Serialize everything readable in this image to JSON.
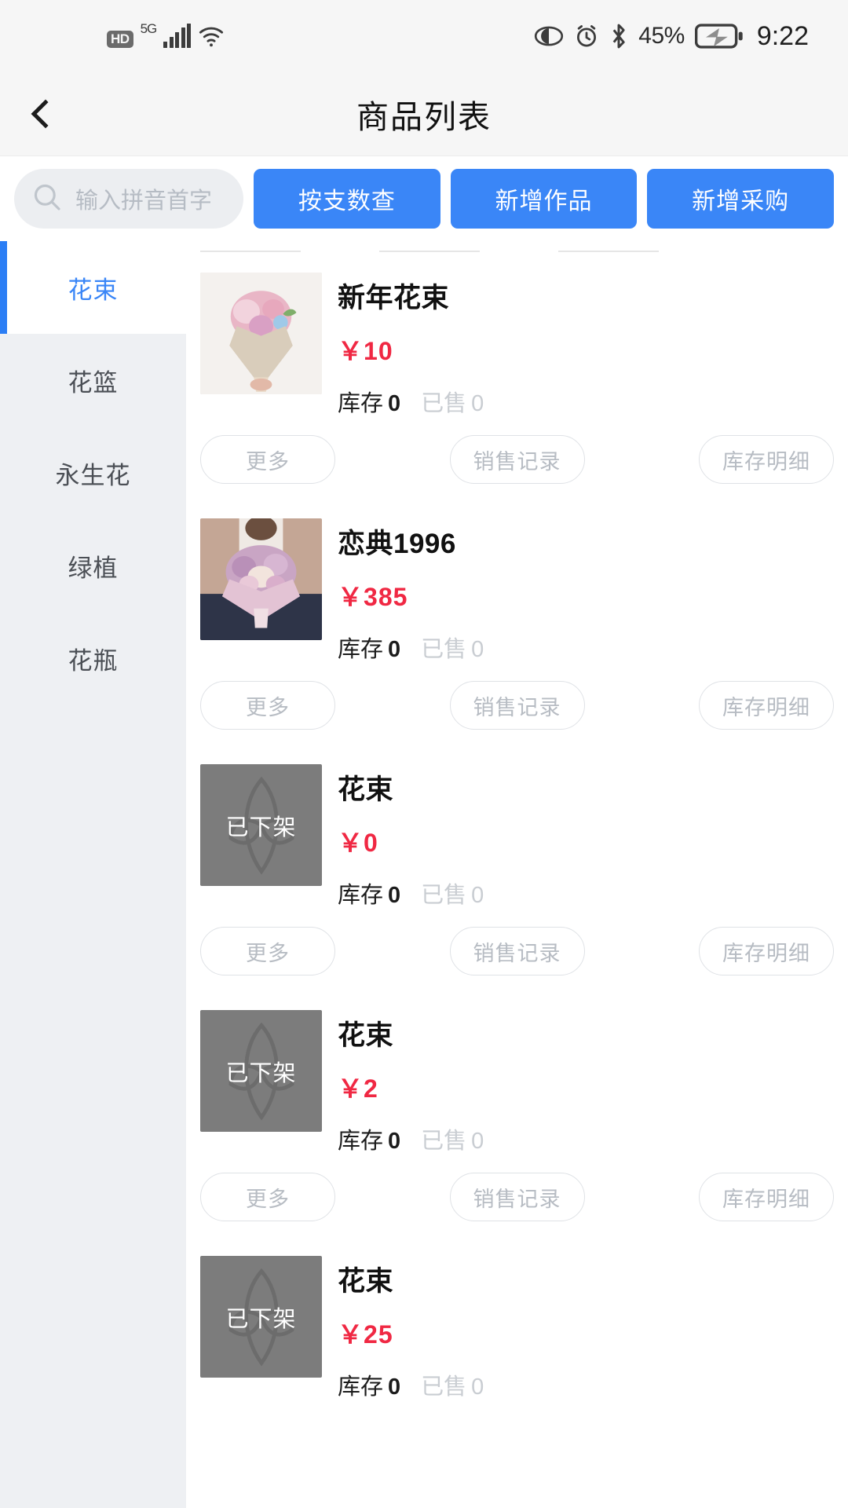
{
  "status_bar": {
    "hd_label": "HD",
    "network_label": "5G",
    "battery_percent": "45%",
    "time": "9:22",
    "icons": [
      "hd-icon",
      "5g-icon",
      "signal-bars-icon",
      "wifi-icon",
      "eye-care-icon",
      "alarm-icon",
      "bluetooth-icon",
      "battery-charging-icon"
    ]
  },
  "header": {
    "back_label": "back",
    "title": "商品列表"
  },
  "toolbar": {
    "search_placeholder": "输入拼音首字",
    "search_value": "",
    "buttons": [
      {
        "label": "按支数查"
      },
      {
        "label": "新增作品"
      },
      {
        "label": "新增采购"
      }
    ]
  },
  "sidebar": {
    "items": [
      {
        "label": "花束",
        "active": true
      },
      {
        "label": "花篮",
        "active": false
      },
      {
        "label": "永生花",
        "active": false
      },
      {
        "label": "绿植",
        "active": false
      },
      {
        "label": "花瓶",
        "active": false
      }
    ]
  },
  "product_list": {
    "action_labels": {
      "more": "更多",
      "sales": "销售记录",
      "stock": "库存明细"
    },
    "stock_label": "库存",
    "sold_label": "已售",
    "currency": "￥",
    "offline_badge": "已下架",
    "items": [
      {
        "name": "新年花束",
        "price": "10",
        "stock": "0",
        "sold": "0",
        "offline": false,
        "image": "pink-bouquet-photo"
      },
      {
        "name": "恋典1996",
        "price": "385",
        "stock": "0",
        "sold": "0",
        "offline": false,
        "image": "purple-bouquet-photo"
      },
      {
        "name": "花束",
        "price": "0",
        "stock": "0",
        "sold": "0",
        "offline": true,
        "image": "offline-placeholder"
      },
      {
        "name": "花束",
        "price": "2",
        "stock": "0",
        "sold": "0",
        "offline": true,
        "image": "offline-placeholder"
      },
      {
        "name": "花束",
        "price": "25",
        "stock": "0",
        "sold": "0",
        "offline": true,
        "image": "offline-placeholder"
      }
    ]
  },
  "colors": {
    "accent_blue": "#3a86f7",
    "price_red": "#f02843",
    "sidebar_bg": "#eef0f3",
    "muted_text": "#b7bcc3"
  }
}
